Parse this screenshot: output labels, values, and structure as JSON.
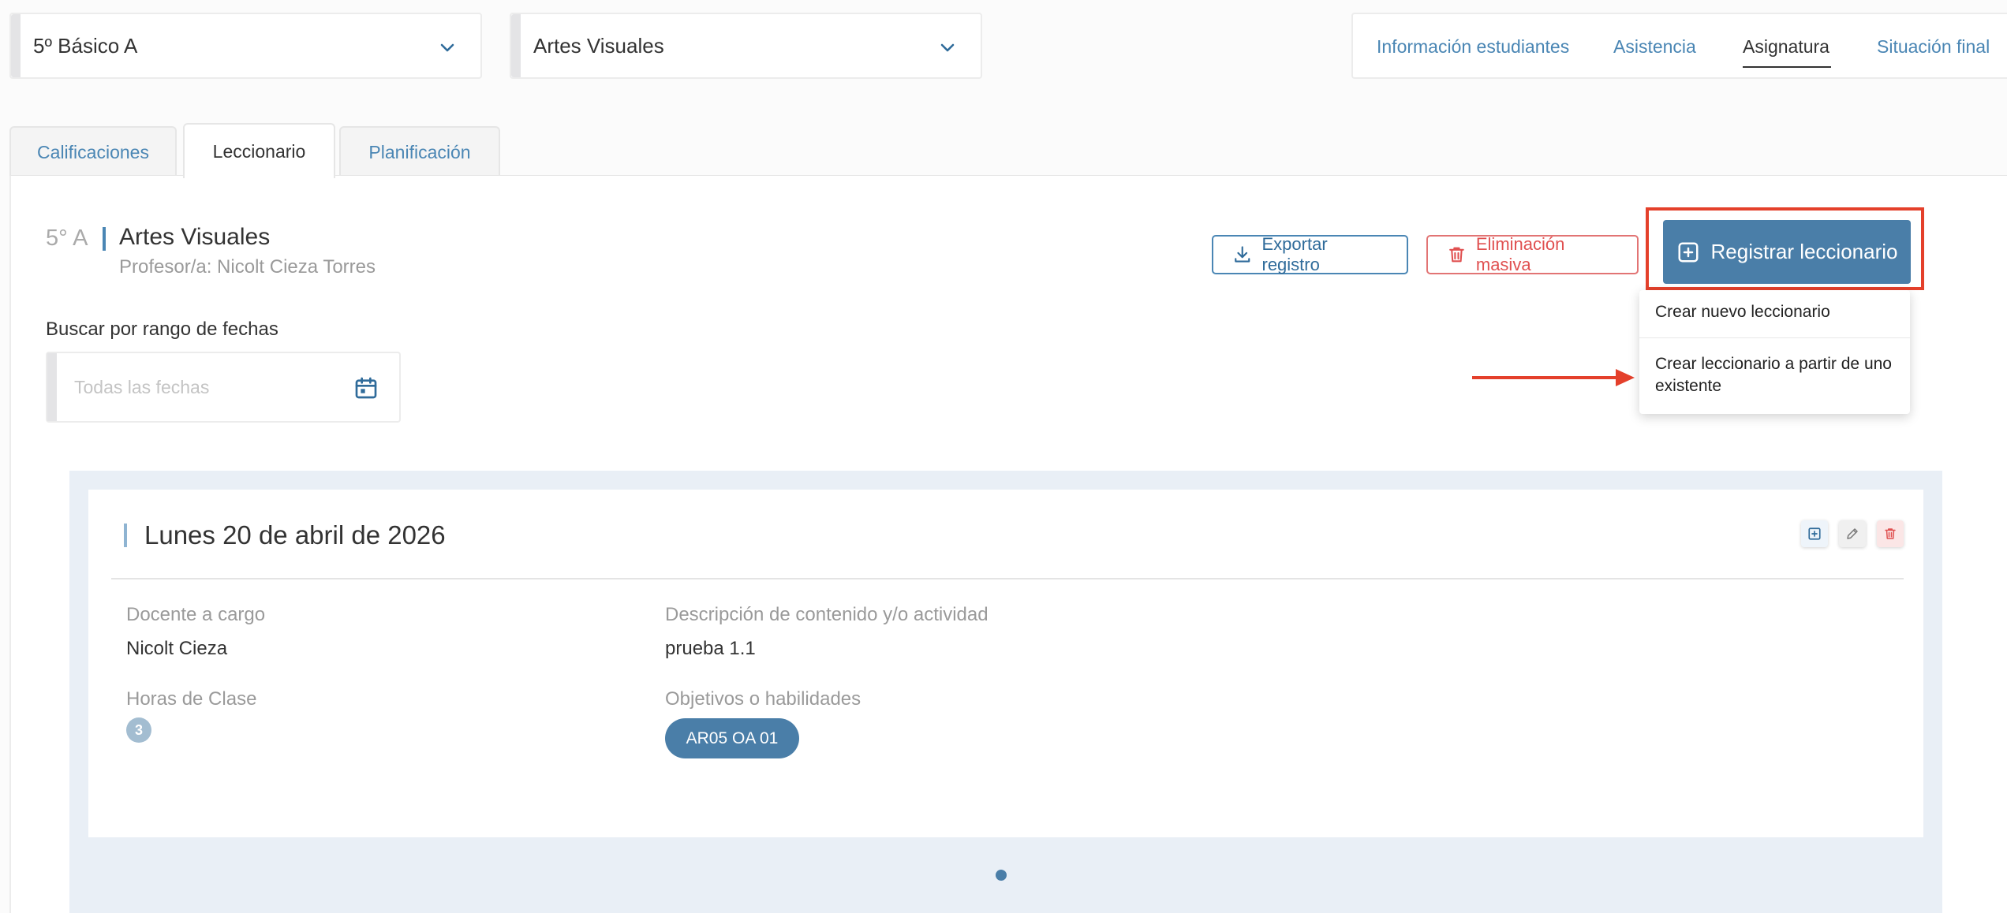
{
  "filters": {
    "course": "5º Básico A",
    "subject": "Artes Visuales"
  },
  "topnav": {
    "items": [
      "Información estudiantes",
      "Asistencia",
      "Asignatura",
      "Situación final"
    ],
    "active": "Asignatura"
  },
  "tabs": {
    "items": [
      "Calificaciones",
      "Leccionario",
      "Planificación"
    ],
    "active": "Leccionario"
  },
  "course_header": {
    "code": "5° A",
    "subject": "Artes Visuales",
    "teacher": "Profesor/a: Nicolt Cieza Torres"
  },
  "actions": {
    "export_label": "Exportar registro",
    "delete_label": "Eliminación masiva",
    "register_label": "Registrar leccionario"
  },
  "register_menu": {
    "option_new": "Crear nuevo leccionario",
    "option_from_existing_line1": "Crear leccionario a partir de uno",
    "option_from_existing_line2": "existente"
  },
  "date_search": {
    "label": "Buscar por rango de fechas",
    "placeholder": "Todas las fechas"
  },
  "entry": {
    "date": "Lunes 20 de abril de 2026",
    "teacher_label": "Docente a cargo",
    "teacher_value": "Nicolt Cieza",
    "description_label": "Descripción de contenido y/o actividad",
    "description_value": "prueba 1.1",
    "hours_label": "Horas de Clase",
    "hours_value": "3",
    "objectives_label": "Objetivos o habilidades",
    "objectives": [
      "AR05 OA 01"
    ]
  },
  "colors": {
    "accent": "#4a7ea8",
    "link": "#4a86b4",
    "danger": "#e05050",
    "highlight": "#e4402b"
  },
  "icons": {
    "select_chevron": "chevron-down-icon",
    "export": "download-icon",
    "delete": "trash-icon",
    "register": "plus-square-icon",
    "calendar": "calendar-icon",
    "entry_add": "plus-square-icon",
    "entry_edit": "pencil-icon",
    "entry_delete": "trash-icon"
  }
}
